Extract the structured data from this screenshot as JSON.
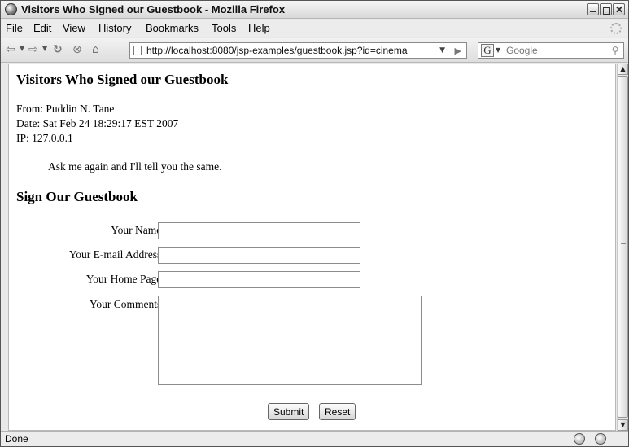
{
  "window": {
    "title": "Visitors Who Signed our Guestbook - Mozilla Firefox"
  },
  "menubar": {
    "items": [
      "File",
      "Edit",
      "View",
      "History",
      "Bookmarks",
      "Tools",
      "Help"
    ]
  },
  "toolbar": {
    "url": "http://localhost:8080/jsp-examples/guestbook.jsp?id=cinema",
    "search_placeholder": "Google",
    "search_engine_letter": "G",
    "icons": [
      "back-icon",
      "forward-icon",
      "reload-icon",
      "stop-icon",
      "home-icon",
      "page-icon",
      "go-icon",
      "search-icon"
    ]
  },
  "page": {
    "heading": "Visitors Who Signed our Guestbook",
    "entry": {
      "from": "From: Puddin N. Tane",
      "date": "Date: Sat Feb 24 18:29:17 EST 2007",
      "ip": "IP: 127.0.0.1",
      "comment": "Ask me again and I'll tell you the same."
    },
    "form_heading": "Sign Our Guestbook",
    "form": {
      "name_label": "Your Name:",
      "email_label": "Your E-mail Address:",
      "homepage_label": "Your Home Page:",
      "comments_label": "Your Comments:",
      "name_value": "",
      "email_value": "",
      "homepage_value": "",
      "comments_value": "",
      "submit_label": "Submit",
      "reset_label": "Reset"
    }
  },
  "statusbar": {
    "text": "Done"
  }
}
